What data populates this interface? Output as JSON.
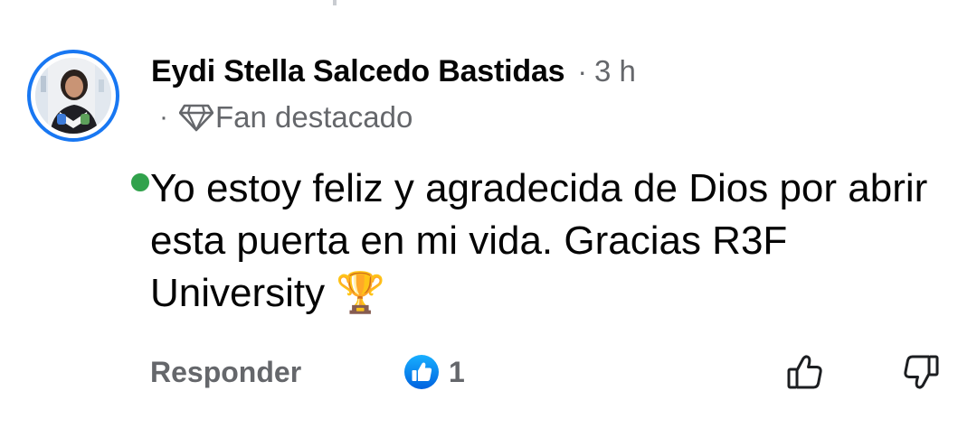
{
  "comment": {
    "author": "Eydi Stella Salcedo Bastidas",
    "separator": "·",
    "time": "3 h",
    "badge": {
      "separator": "·",
      "icon": "diamond-icon",
      "label": "Fan destacado"
    },
    "text": "Yo estoy feliz y agradecida de Dios por abrir esta puerta en mi vida. Gracias R3F University 🏆",
    "avatar_ring_color": "#1877f2",
    "online_status_color": "#31a24c"
  },
  "actions": {
    "reply_label": "Responder",
    "reaction_icon": "like-reaction-icon",
    "reaction_count": "1",
    "like_icon": "thumbs-up-outline-icon",
    "dislike_icon": "thumbs-down-outline-icon"
  },
  "colors": {
    "primary_text": "#050505",
    "secondary_text": "#65676b",
    "facebook_blue": "#1877f2"
  }
}
